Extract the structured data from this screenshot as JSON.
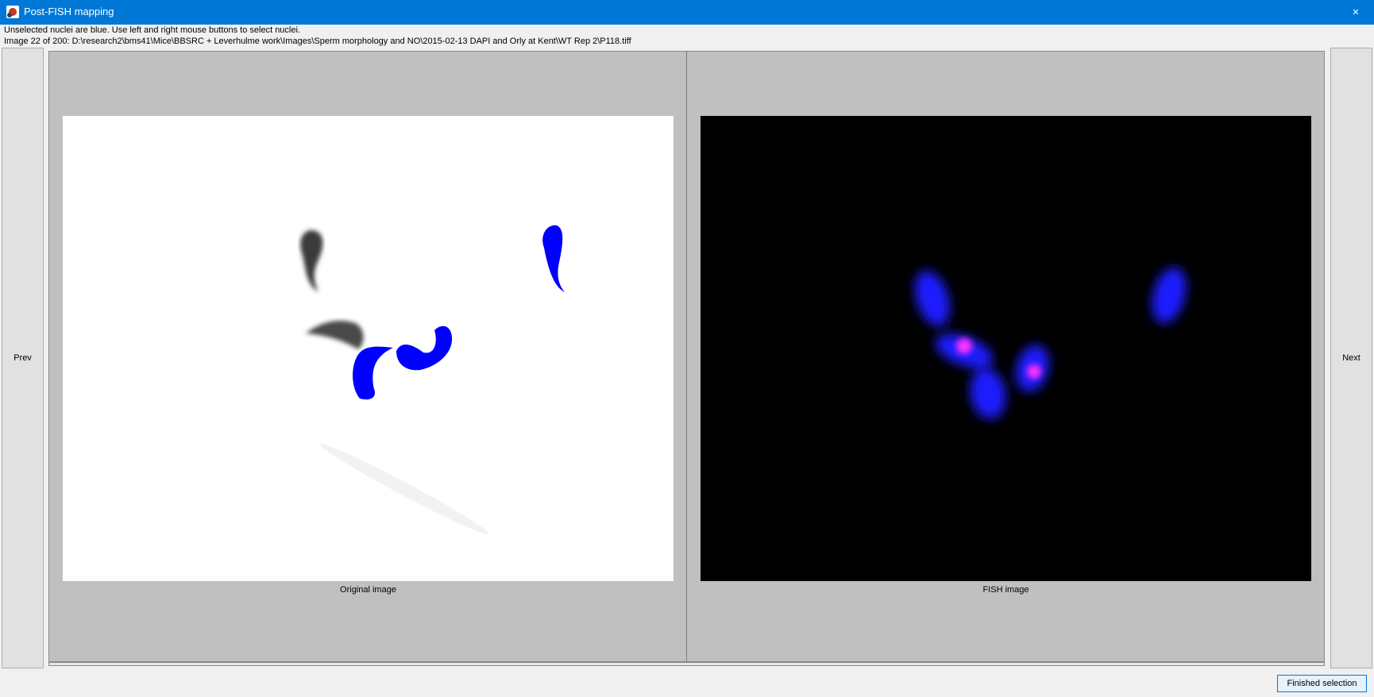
{
  "window": {
    "title": "Post-FISH mapping",
    "close_glyph": "✕"
  },
  "info": {
    "instructions": "Unselected nuclei are blue. Use left and right mouse buttons to select nuclei.",
    "image_status": "Image 22 of 200: D:\\research2\\bms41\\Mice\\BBSRC + Leverhulme work\\Images\\Sperm morphology and NO\\2015-02-13 DAPI and Orly at Kent\\WT Rep 2\\P118.tiff"
  },
  "nav": {
    "prev_label": "Prev",
    "next_label": "Next"
  },
  "panels": {
    "original_caption": "Original image",
    "fish_caption": "FISH image"
  },
  "footer": {
    "finish_label": "Finished selection"
  },
  "colors": {
    "title_bar": "#0078d7",
    "nucleus_unselected": "#0000ff",
    "fish_signal": "#ff33ff",
    "panel_bg": "#c0c0c0"
  }
}
